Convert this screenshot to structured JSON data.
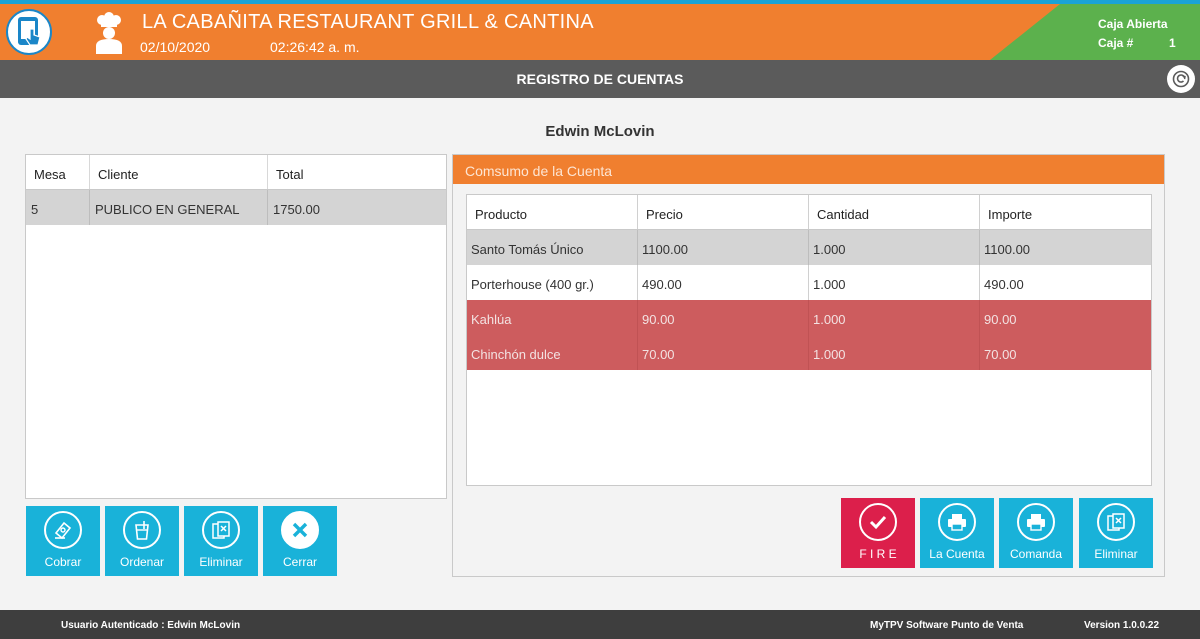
{
  "header": {
    "restaurant_name": "LA CABAÑITA RESTAURANT GRILL & CANTINA",
    "date": "02/10/2020",
    "time": "02:26:42 a. m.",
    "caja_status": "Caja Abierta",
    "caja_label": "Caja #",
    "caja_number": "1"
  },
  "titlebar": {
    "title": "REGISTRO DE CUENTAS"
  },
  "user_name": "Edwin McLovin",
  "accounts_table": {
    "columns": [
      "Mesa",
      "Cliente",
      "Total"
    ],
    "rows": [
      {
        "mesa": "5",
        "cliente": "PUBLICO EN GENERAL",
        "total": "1750.00"
      }
    ]
  },
  "left_buttons": {
    "cobrar": "Cobrar",
    "ordenar": "Ordenar",
    "eliminar": "Eliminar",
    "cerrar": "Cerrar"
  },
  "consumption": {
    "title": "Comsumo de la Cuenta",
    "columns": [
      "Producto",
      "Precio",
      "Cantidad",
      "Importe"
    ],
    "rows": [
      {
        "producto": "Santo Tomás Único",
        "precio": "1100.00",
        "cantidad": "1.000",
        "importe": "1100.00"
      },
      {
        "producto": "Porterhouse (400 gr.)",
        "precio": "490.00",
        "cantidad": "1.000",
        "importe": "490.00"
      },
      {
        "producto": "Kahlúa",
        "precio": "90.00",
        "cantidad": "1.000",
        "importe": "90.00"
      },
      {
        "producto": "Chinchón dulce",
        "precio": "70.00",
        "cantidad": "1.000",
        "importe": "70.00"
      }
    ]
  },
  "right_buttons": {
    "fire": "F I R E",
    "la_cuenta": "La Cuenta",
    "comanda": "Comanda",
    "eliminar": "Eliminar"
  },
  "footer": {
    "user": "Usuario Autenticado : Edwin McLovin",
    "software": "MyTPV Software Punto de Venta",
    "version": "Version 1.0.0.22"
  },
  "colors": {
    "orange": "#f07f2f",
    "blue": "#19b2d9",
    "green": "#5cb14d",
    "fire_red": "#dc1f4b",
    "row_red": "#cd5c5e"
  }
}
